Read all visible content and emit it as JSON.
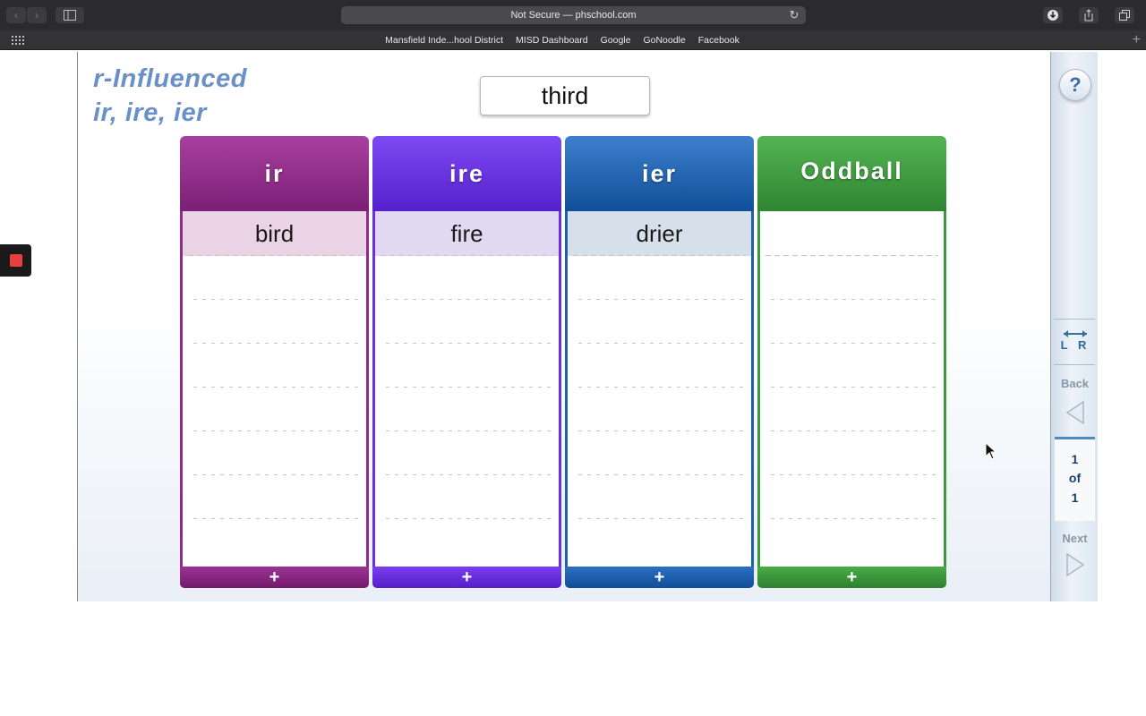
{
  "browser": {
    "address": "Not Secure — phschool.com",
    "bookmarks": [
      "Mansfield Inde...hool District",
      "MISD Dashboard",
      "Google",
      "GoNoodle",
      "Facebook"
    ]
  },
  "activity": {
    "title_line1": "r-Influenced",
    "title_line2": "ir, ire, ier",
    "current_word": "third",
    "columns": [
      {
        "header": "ir",
        "first_word": "bird",
        "color": "#8e2a87",
        "tint": "#ead3e5"
      },
      {
        "header": "ire",
        "first_word": "fire",
        "color": "#6a2fe0",
        "tint": "#e1d9f2"
      },
      {
        "header": "ier",
        "first_word": "drier",
        "color": "#1c5fae",
        "tint": "#d5e0ea"
      },
      {
        "header": "Oddball",
        "first_word": "",
        "color": "#3b9a3a",
        "tint": "#ffffff"
      }
    ],
    "add_symbol": "+"
  },
  "controls": {
    "help": "?",
    "lr_label": "L R",
    "back": "Back",
    "page_current": "1",
    "page_of": "of",
    "page_total": "1",
    "next": "Next"
  }
}
